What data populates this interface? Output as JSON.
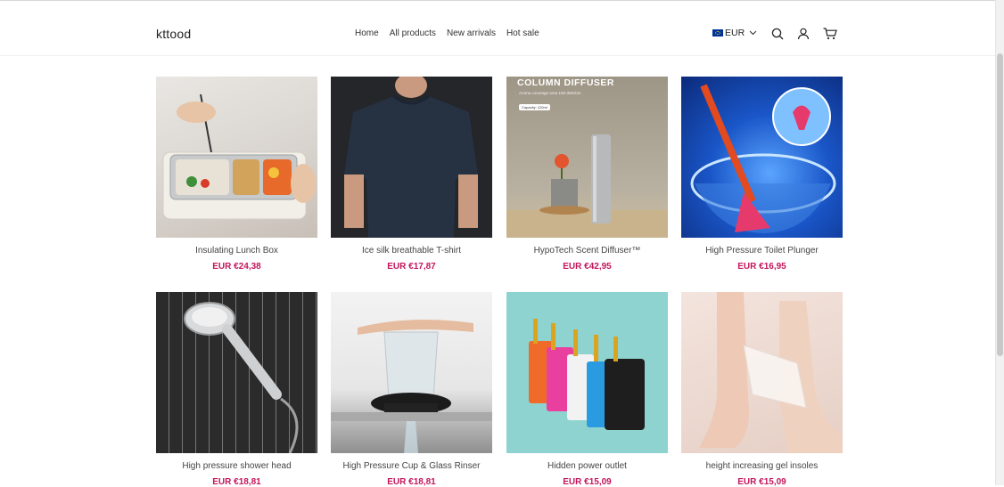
{
  "header": {
    "logo": "kttood",
    "nav": [
      "Home",
      "All products",
      "New arrivals",
      "Hot sale"
    ],
    "currency": "EUR",
    "icons": [
      "search-icon",
      "account-icon",
      "cart-icon"
    ]
  },
  "image_text": {
    "diffuser_heading": "COLUMN DIFFUSER",
    "diffuser_sub": "Aroma coverage area 100-300cbm",
    "diffuser_capacity": "Capacity: 120ml"
  },
  "products": [
    {
      "title": "Insulating Lunch Box",
      "price": "EUR €24,38"
    },
    {
      "title": "Ice silk breathable T-shirt",
      "price": "EUR €17,87"
    },
    {
      "title": "HypoTech Scent Diffuser™",
      "price": "EUR €42,95"
    },
    {
      "title": "High Pressure Toilet Plunger",
      "price": "EUR €16,95"
    },
    {
      "title": "High pressure shower head",
      "price": "EUR €18,81"
    },
    {
      "title": "High Pressure Cup & Glass Rinser",
      "price": "EUR €18,81"
    },
    {
      "title": "Hidden power outlet",
      "price": "EUR €15,09"
    },
    {
      "title": "height increasing gel insoles",
      "price": "EUR €15,09"
    }
  ],
  "colors": {
    "price": "#c3155c",
    "text": "#222222"
  }
}
